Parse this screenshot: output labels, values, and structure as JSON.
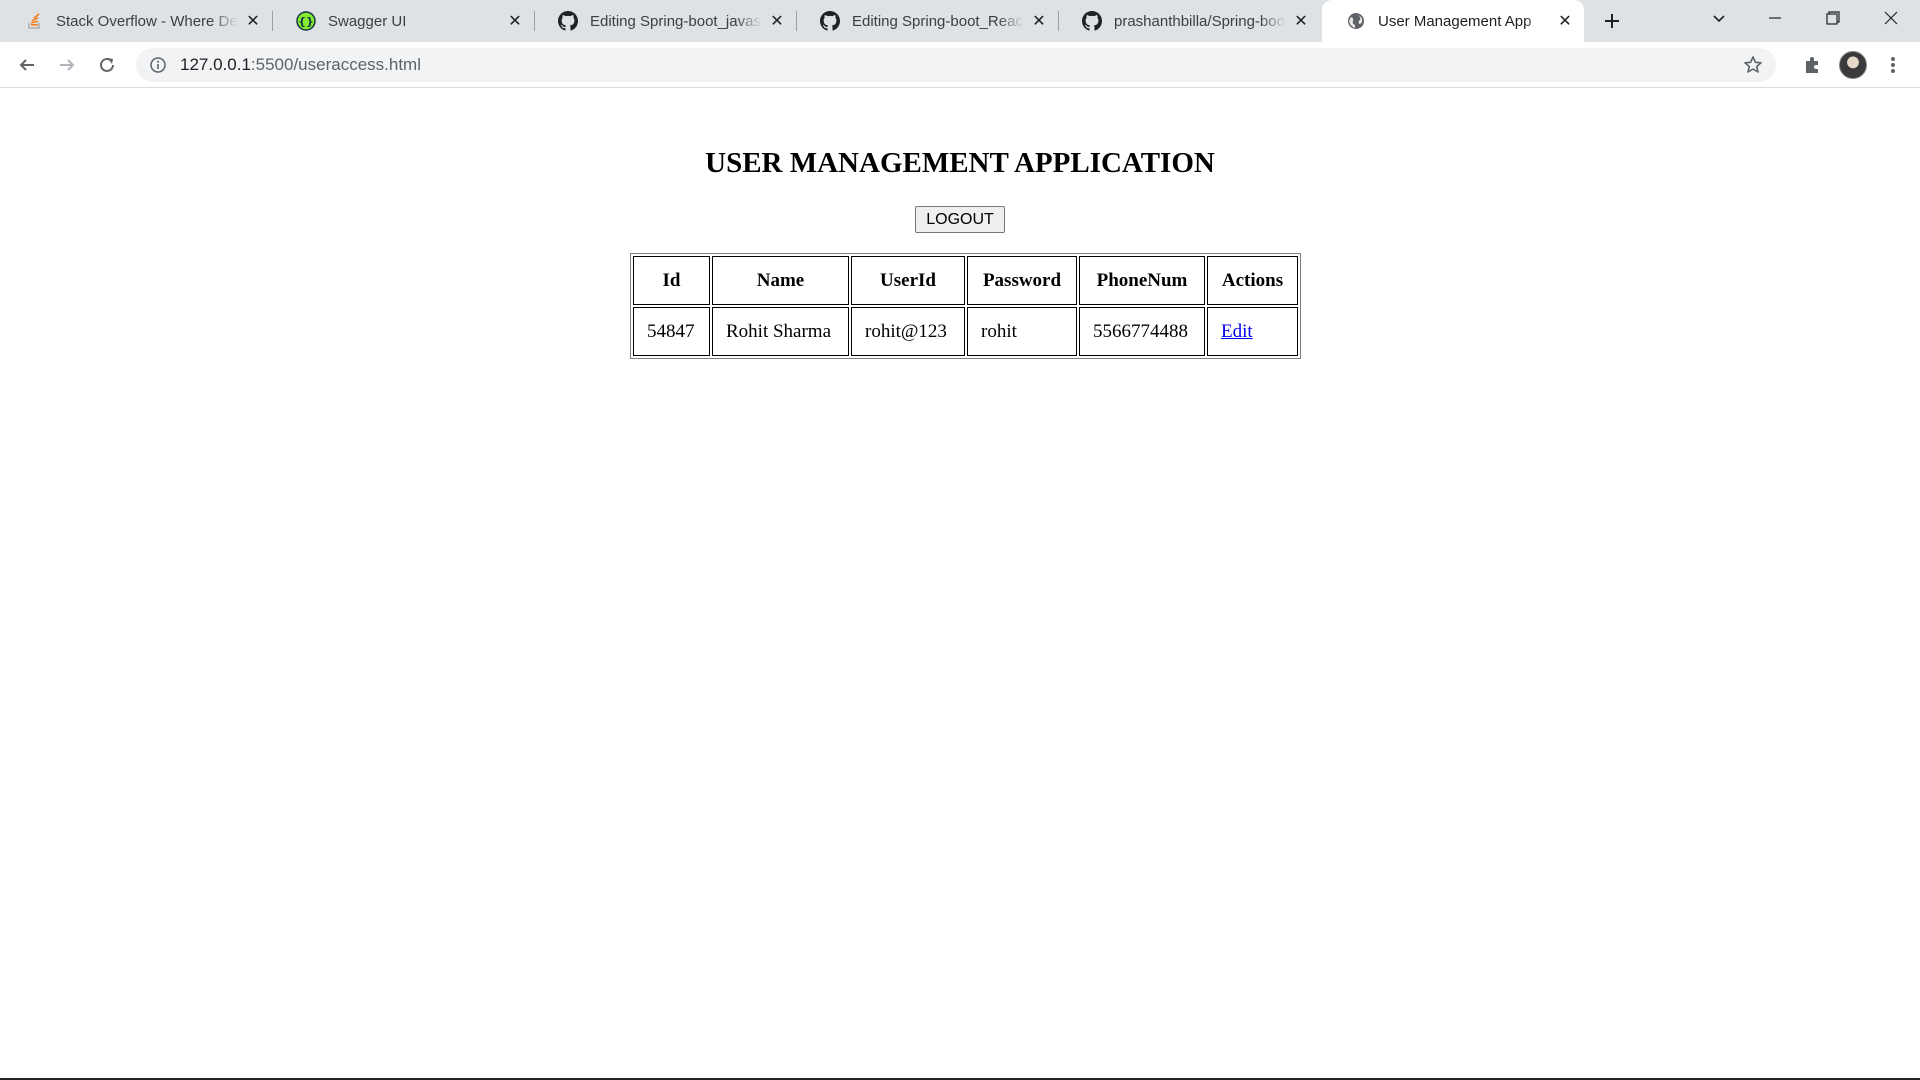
{
  "browser": {
    "tabs": [
      {
        "title": "Stack Overflow - Where Developers Learn, Share, & Build Careers",
        "favicon": "stackoverflow-icon"
      },
      {
        "title": "Swagger UI",
        "favicon": "swagger-icon"
      },
      {
        "title": "Editing Spring-boot_javascript",
        "favicon": "github-icon"
      },
      {
        "title": "Editing Spring-boot_ReactJs",
        "favicon": "github-icon"
      },
      {
        "title": "prashanthbilla/Spring-boot",
        "favicon": "github-icon"
      },
      {
        "title": "User Management App",
        "favicon": "globe-icon",
        "active": true
      }
    ],
    "address": {
      "host": "127.0.0.1",
      "rest": ":5500/useraccess.html"
    }
  },
  "page": {
    "title": "USER MANAGEMENT APPLICATION",
    "logout_label": "LOGOUT",
    "table": {
      "headers": [
        "Id",
        "Name",
        "UserId",
        "Password",
        "PhoneNum",
        "Actions"
      ],
      "rows": [
        {
          "id": "54847",
          "name": "Rohit Sharma",
          "userid": "rohit@123",
          "password": "rohit",
          "phone": "5566774488",
          "action": "Edit"
        }
      ]
    }
  }
}
